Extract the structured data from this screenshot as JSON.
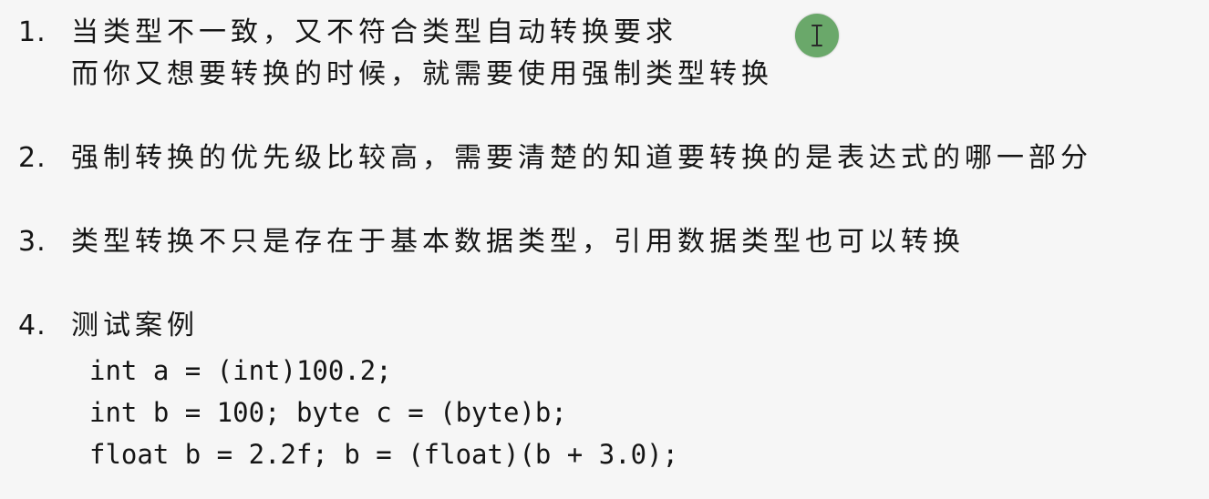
{
  "items": [
    {
      "number": "1.",
      "lines": [
        "当类型不一致，又不符合类型自动转换要求",
        "而你又想要转换的时候，就需要使用强制类型转换"
      ]
    },
    {
      "number": "2.",
      "lines": [
        "强制转换的优先级比较高，需要清楚的知道要转换的是表达式的哪一部分"
      ]
    },
    {
      "number": "3.",
      "lines": [
        "类型转换不只是存在于基本数据类型，引用数据类型也可以转换"
      ]
    },
    {
      "number": "4.",
      "lines": [
        "测试案例"
      ],
      "code": [
        "int a = (int)100.2;",
        "int b = 100; byte c = (byte)b;",
        "float b = 2.2f; b = (float)(b + 3.0);"
      ]
    }
  ],
  "cursor": {
    "icon": "text-cursor-icon",
    "color": "#6aa86a"
  }
}
